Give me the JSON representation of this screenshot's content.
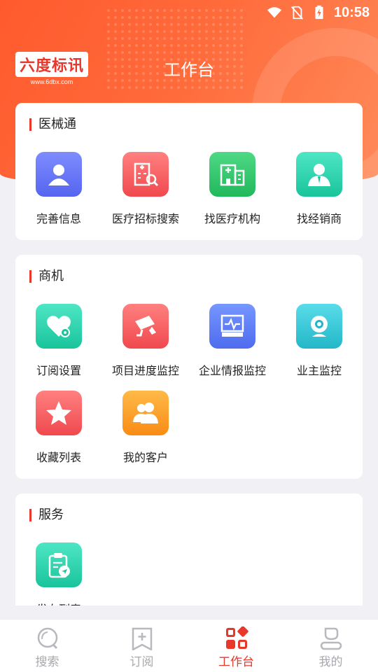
{
  "status_bar": {
    "time": "10:58"
  },
  "header": {
    "logo_text": "六度标讯",
    "logo_url": "www.6dbx.com",
    "title": "工作台"
  },
  "sections": [
    {
      "title": "医械通",
      "items": [
        {
          "label": "完善信息",
          "icon": "user-icon",
          "color": "#6673f5"
        },
        {
          "label": "医疗招标搜索",
          "icon": "hospital-search-icon",
          "color": "#f4585b"
        },
        {
          "label": "找医疗机构",
          "icon": "hospital-icon",
          "color": "#2bbf63"
        },
        {
          "label": "找经销商",
          "icon": "businessman-icon",
          "color": "#20c9a0"
        }
      ]
    },
    {
      "title": "商机",
      "items": [
        {
          "label": "订阅设置",
          "icon": "heart-settings-icon",
          "color": "#20c9a0"
        },
        {
          "label": "项目进度监控",
          "icon": "cctv-camera-icon",
          "color": "#f4585b"
        },
        {
          "label": "企业情报监控",
          "icon": "monitor-pulse-icon",
          "color": "#5a75f0"
        },
        {
          "label": "业主监控",
          "icon": "webcam-icon",
          "color": "#2bbccc"
        },
        {
          "label": "收藏列表",
          "icon": "star-icon",
          "color": "#f4585b"
        },
        {
          "label": "我的客户",
          "icon": "customers-icon",
          "color": "#fb951f"
        }
      ]
    },
    {
      "title": "服务",
      "items": [
        {
          "label": "发布列表",
          "icon": "clipboard-send-icon",
          "color": "#20c9a0"
        }
      ]
    }
  ],
  "bottom_nav": [
    {
      "label": "搜索",
      "icon": "search-icon",
      "active": false
    },
    {
      "label": "订阅",
      "icon": "subscribe-icon",
      "active": false
    },
    {
      "label": "工作台",
      "icon": "workbench-icon",
      "active": true
    },
    {
      "label": "我的",
      "icon": "profile-icon",
      "active": false
    }
  ],
  "colors": {
    "accent": "#e8372b",
    "inactive": "#a8a8ae"
  }
}
